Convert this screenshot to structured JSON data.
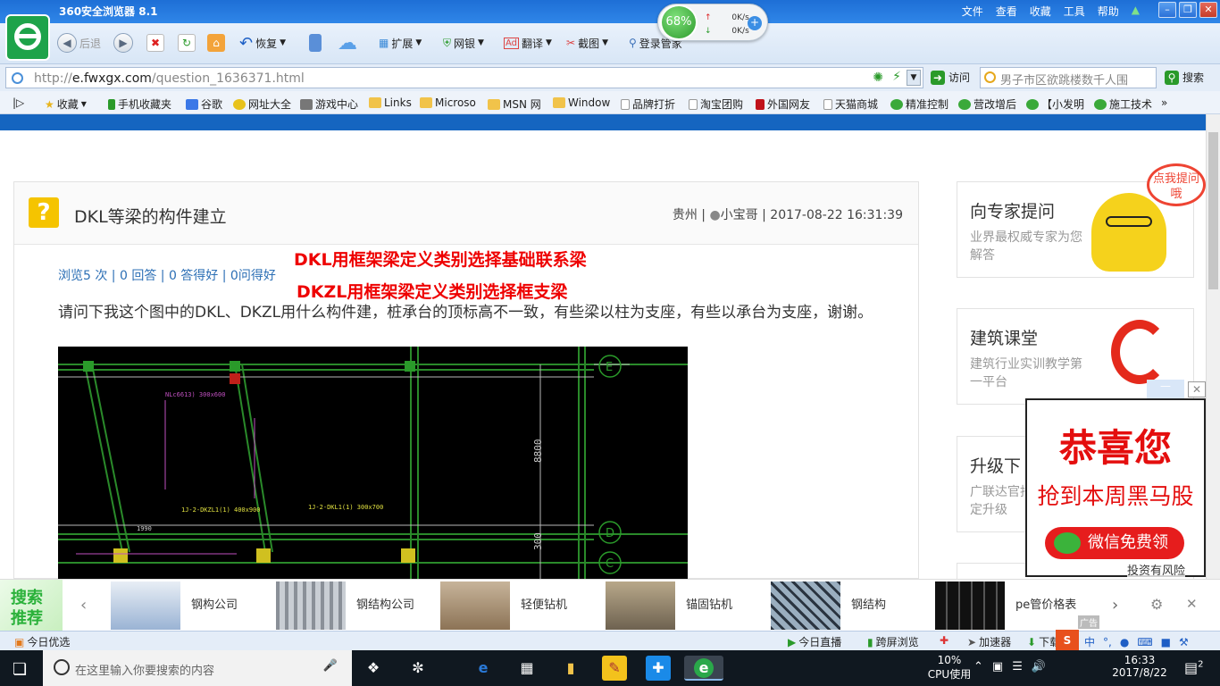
{
  "browser": {
    "title": "360安全浏览器 8.1",
    "menu": [
      "文件",
      "查看",
      "收藏",
      "工具",
      "帮助"
    ],
    "toolbar": {
      "back": "后退",
      "restore": "恢复",
      "extend": "扩展",
      "ebank": "网银",
      "translate": "翻译",
      "screenshot": "截图",
      "login": "登录管家"
    },
    "meter": {
      "percent": "68%",
      "up": "0K/s",
      "down": "0K/s"
    },
    "url_prefix": "http://",
    "url_host": "e.fwxgx.com",
    "url_path": "/question_1636371.html",
    "go_label": "访问",
    "search_value": "男子市区欲跳楼数千人围",
    "search_label": "搜索",
    "favorites": [
      "收藏",
      "手机收藏夹",
      "谷歌",
      "网址大全",
      "游戏中心",
      "Links",
      "Microso",
      "MSN 网",
      "Window",
      "品牌打折",
      "淘宝团购",
      "外国网友",
      "天猫商城",
      "精准控制",
      "营改增后",
      "【小发明",
      "施工技术"
    ]
  },
  "question": {
    "title": "DKL等梁的构件建立",
    "meta_location": "贵州",
    "meta_user": "小宝哥",
    "meta_time": "2017-08-22 16:31:39",
    "stats": "浏览5 次 | 0 回答 | 0 答得好 | 0问得好",
    "annotation_1": "DKL用框架梁定义类别选择基础联系梁",
    "annotation_2": "DKZL用框架梁定义类别选择框支梁",
    "body": "请问下我这个图中的DKL、DKZL用什么构件建，桩承台的顶标高不一致，有些梁以柱为支座，有些以承台为支座，谢谢。",
    "cad_labels": {
      "axis_e": "E",
      "axis_d": "D",
      "axis_c": "C",
      "dim_8800": "8800",
      "dim_300": "300",
      "dim_1990": "1990",
      "text_1": "1J-2-DKZL1(1) 400x900",
      "text_2": "1J-2-DKL1(1) 300x700",
      "text_3": "NLc6613) 300x600"
    }
  },
  "sidebar": {
    "expert": {
      "title": "向专家提问",
      "desc": "业界最权威专家为您解答",
      "bubble": "点我提问哦"
    },
    "course": {
      "title": "建筑课堂",
      "desc": "建筑行业实训教学第一平台"
    },
    "upgrade": {
      "title": "升级下",
      "desc": "广联达官指定升级"
    }
  },
  "ad": {
    "headline": "恭喜您",
    "subline": "抢到本周黑马股",
    "button": "微信免费领",
    "footer": "投资有风险"
  },
  "strip": {
    "badge": "搜索推荐",
    "items": [
      "钢构公司",
      "钢结构公司",
      "轻便钻机",
      "锚固钻机",
      "钢结构",
      "pe管价格表"
    ],
    "ad_tag": "广告"
  },
  "statusbar": {
    "today": "今日优选",
    "live": "今日直播",
    "cross": "跨屏浏览",
    "accel": "加速器",
    "download": "下载",
    "ime": "中"
  },
  "taskbar": {
    "search_placeholder": "在这里输入你要搜索的内容",
    "cpu_value": "10%",
    "cpu_label": "CPU使用",
    "time": "16:33",
    "date": "2017/8/22",
    "notifications": "2"
  }
}
